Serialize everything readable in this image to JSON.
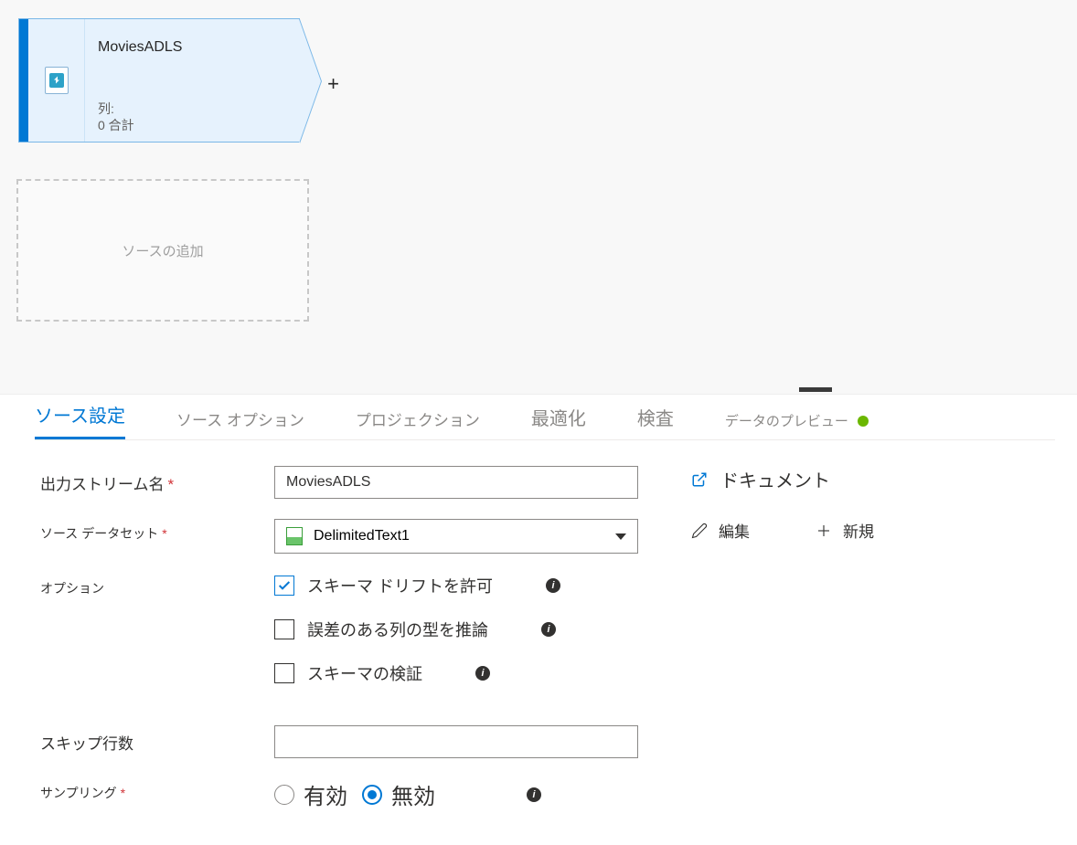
{
  "canvas": {
    "source_node": {
      "title": "MoviesADLS",
      "columns_label": "列:",
      "columns_value": "0 合計"
    },
    "add_source_label": "ソースの追加",
    "plus": "+"
  },
  "tabs": [
    {
      "label": "ソース設定",
      "active": true
    },
    {
      "label": "ソース オプション",
      "active": false
    },
    {
      "label": "プロジェクション",
      "active": false
    },
    {
      "label": "最適化",
      "active": false
    },
    {
      "label": "検査",
      "active": false
    },
    {
      "label": "データのプレビュー",
      "active": false,
      "status": "green"
    }
  ],
  "form": {
    "output_stream": {
      "label": "出力ストリーム名",
      "value": "MoviesADLS"
    },
    "dataset": {
      "label": "ソース データセット",
      "value": "DelimitedText1"
    },
    "doc_link": "ドキュメント",
    "edit_label": "編集",
    "new_label": "新規",
    "options_label": "オプション",
    "options": {
      "drift": "スキーマ ドリフトを許可",
      "infer": "誤差のある列の型を推論",
      "validate": "スキーマの検証"
    },
    "skip_lines": {
      "label": "スキップ行数",
      "value": ""
    },
    "sampling": {
      "label": "サンプリング",
      "enable": "有効",
      "disable": "無効"
    }
  }
}
